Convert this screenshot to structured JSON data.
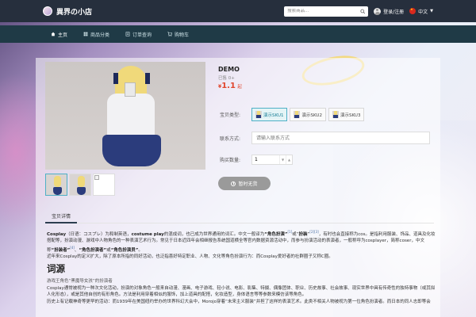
{
  "header": {
    "site_name": "異界の小店",
    "search_placeholder": "搜索商品...",
    "login_label": "登录/注册",
    "language_label": "中文"
  },
  "nav": {
    "items": [
      {
        "label": "主页",
        "icon": "home-icon"
      },
      {
        "label": "商品分类",
        "icon": "grid-icon"
      },
      {
        "label": "订单查询",
        "icon": "order-icon"
      },
      {
        "label": "购物车",
        "icon": "cart-icon"
      }
    ]
  },
  "product": {
    "title": "DEMO",
    "sold": "已售 0+",
    "currency": "¥",
    "price": "1.1",
    "unit": "起",
    "sku_label": "宝贝类型:",
    "skus": [
      "演示SKU1",
      "演示SKU2",
      "演示SKU3"
    ],
    "contact_label": "联系方式:",
    "contact_placeholder": "请输入联系方式",
    "quantity_label": "购买数量:",
    "quantity_value": "1",
    "buy_label": "暂时无货"
  },
  "tabs": [
    "宝贝详情"
  ],
  "description": {
    "p1_term": "Cosplay",
    "p1_a": "（日语：コスプレ）为和制英语，",
    "p1_b": "costume play",
    "p1_c": "的混成词，也已成为世界通用的词汇。中文一般译为",
    "p1_d": "“角色扮演”",
    "p1_ref1": "[1]",
    "p1_e": "或“",
    "p1_f": "扮装",
    "p1_g": "”",
    "p1_ref2": "[2][3]",
    "p1_h": "，有时也会直接称为cos。是指利用服装、饰品、道具及化妆搭配等，扮演动漫、游戏中人物角色的一种表演艺术行为。常见于日本近四年会相继报告系统国道横全等官内数据资源活动中，而参与扮演活动的表演者，一般称呼为cosplayer，简称coser，中文称",
    "p1_i": "“扮装者”",
    "p1_ref3": "[4]",
    "p1_j": "、",
    "p1_k": "“角色扮演者”",
    "p1_l": "或",
    "p1_m": "“角色扮演员”",
    "p1_n": "。",
    "p2": "近年来Cosplay的定义扩大，除了原本所指的同好活动，也泛指喜好特定职业、人物、文化等角色扮演行为：而Cosplay爱好者的社群圈子又称C圈。",
    "h2": "词源",
    "p3": "游戏王角色“黑魔导女孩”的扮演者",
    "p4": "Cosplay通常被视为一种次文化活动，扮演的对象角色一般来自动漫、漫画、电子游戏、轻小说、电影、影集、特摄、偶像团体、职业、历史故事、社会故事、现实世界中具有传奇性的独特事物（或其拟人化形态），或是其他自创的有形角色。方法是利用穿着相似的服饰，加上道具的配搭，化妆造型，身体语言等等参数来模仿该等角色。",
    "p5": "历史上有记载神奇等更早的活动：而1939年在美国纽约举办的世界科幻大会中，Morojo穿着“未来主义服装”并担了这样的表演艺术。此类不相关人物被视为第一位角色扮演者。而日本的同人志即等会"
  }
}
